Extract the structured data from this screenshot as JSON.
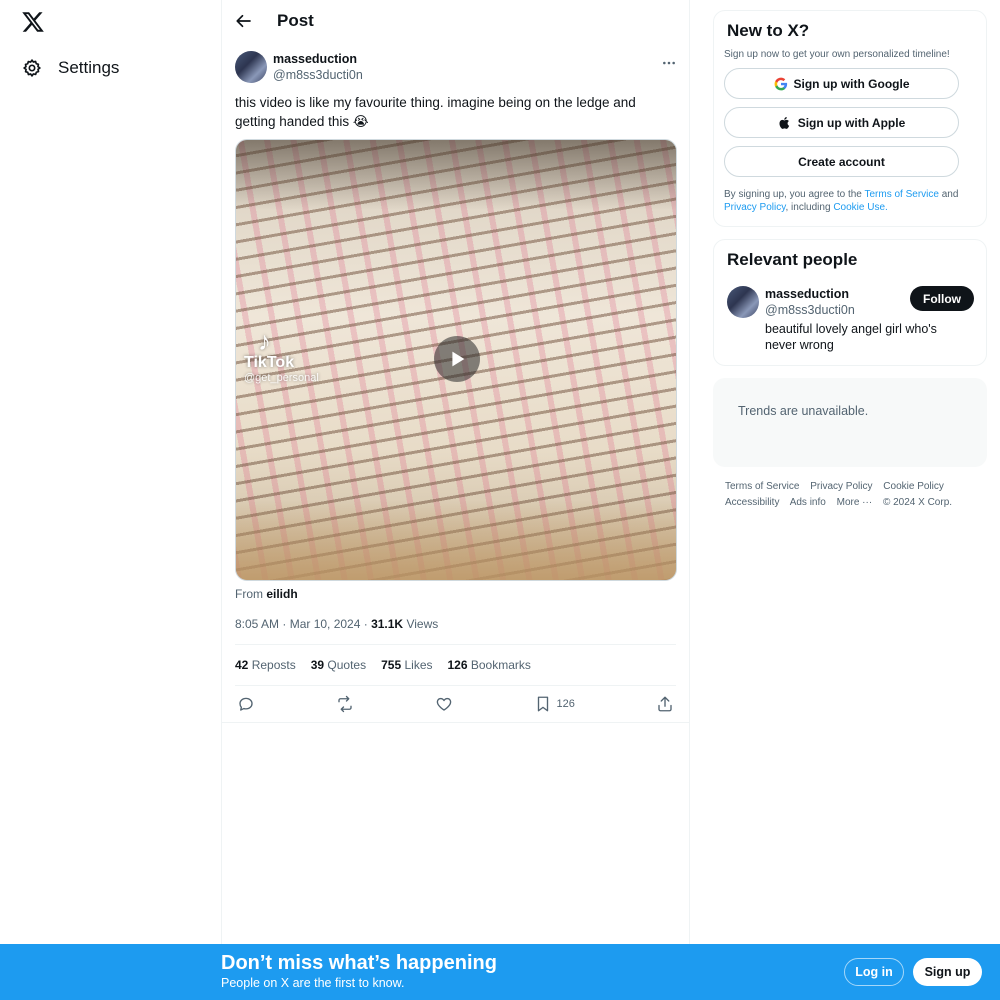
{
  "nav": {
    "logo_icon": "x-logo-icon",
    "settings_label": "Settings",
    "settings_icon": "gear-icon"
  },
  "header": {
    "title": "Post",
    "back_icon": "arrow-left-icon"
  },
  "post": {
    "display_name": "masseduction",
    "handle": "@m8ss3ducti0n",
    "text": "this video is like my favourite thing. imagine being on the ledge and getting handed this 😭",
    "media": {
      "tiktok_logo": "♪",
      "tiktok_name": "TikTok",
      "tiktok_handle": "@get_personal"
    },
    "from_prefix": "From",
    "from_name": "eilidh",
    "time": "8:05 AM · Mar 10, 2024 · ",
    "views_count": "31.1K",
    "views_label": " Views",
    "stats": {
      "reposts_count": "42",
      "reposts_label": " Reposts",
      "quotes_count": "39",
      "quotes_label": " Quotes",
      "likes_count": "755",
      "likes_label": " Likes",
      "bookmarks_count": "126",
      "bookmarks_label": " Bookmarks"
    },
    "actions": {
      "bookmark_count": "126"
    }
  },
  "signup_card": {
    "title": "New to X?",
    "subtitle": "Sign up now to get your own personalized timeline!",
    "google_label": "Sign up with Google",
    "apple_label": "Sign up with Apple",
    "create_label": "Create account",
    "legal_1": "By signing up, you agree to the ",
    "terms_link": "Terms of Service",
    "legal_2": " and ",
    "privacy_link": "Privacy Policy",
    "legal_3": ", including ",
    "cookie_link": "Cookie Use."
  },
  "relevant": {
    "title": "Relevant people",
    "display_name": "masseduction",
    "handle": "@m8ss3ducti0n",
    "bio": "beautiful lovely angel girl who's never wrong",
    "follow_label": "Follow"
  },
  "trends": {
    "text": "Trends are unavailable."
  },
  "footer": {
    "terms": "Terms of Service",
    "privacy": "Privacy Policy",
    "cookie": "Cookie Policy",
    "accessibility": "Accessibility",
    "ads": "Ads info",
    "more": "More ···",
    "copyright": "© 2024 X Corp."
  },
  "bottom_bar": {
    "title": "Don’t miss what’s happening",
    "subtitle": "People on X are the first to know.",
    "login_label": "Log in",
    "signup_label": "Sign up"
  },
  "colors": {
    "accent": "#1d9bf0",
    "text": "#0f1419",
    "muted": "#536471"
  }
}
